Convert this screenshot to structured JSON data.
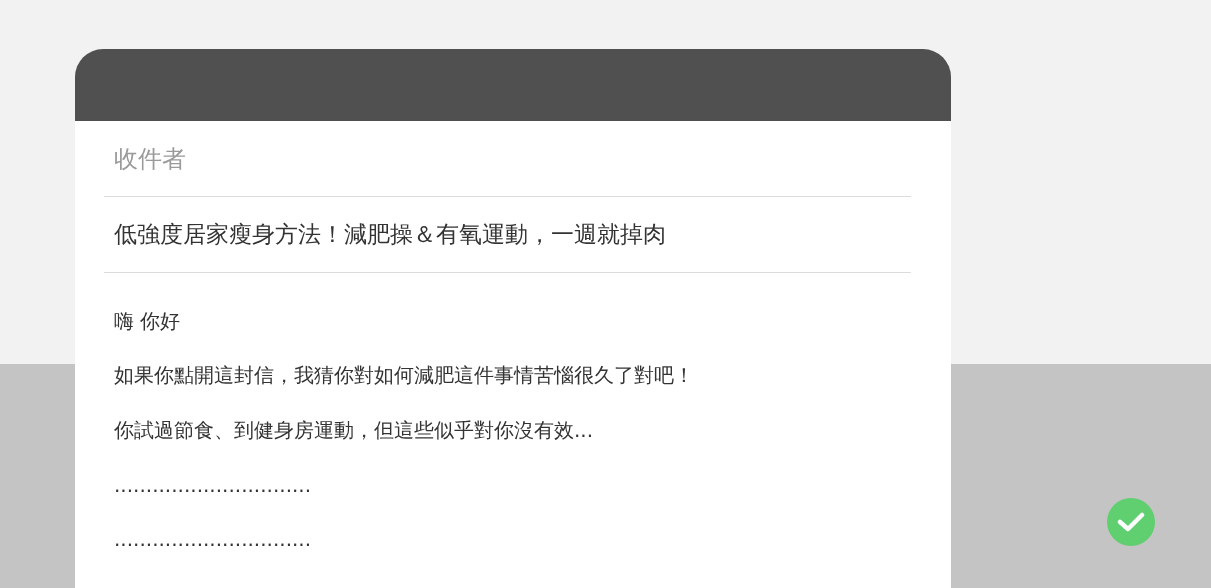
{
  "compose": {
    "recipient": {
      "placeholder": "收件者"
    },
    "subject": "低強度居家瘦身方法！減肥操＆有氧運動，一週就掉肉",
    "body": [
      "嗨 你好",
      "如果你點開這封信，我猜你對如何減肥這件事情苦惱很久了對吧！",
      "你試過節食、到健身房運動，但這些似乎對你沒有效...",
      "...............................",
      "..............................."
    ]
  },
  "send_button": {
    "kind": "check"
  }
}
